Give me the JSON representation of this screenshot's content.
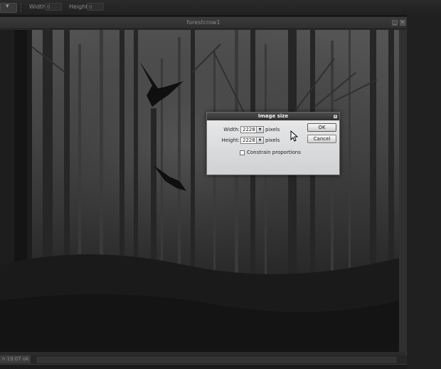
{
  "toolbar": {
    "dropdown_arrow": "▾",
    "width_label": "Width:",
    "width_value": "0",
    "height_label": "Height:",
    "height_value": "0"
  },
  "document": {
    "title": "forestcrow1",
    "status_text": "n 19.07 ok"
  },
  "dialog": {
    "title": "Image size",
    "close_glyph": "×",
    "width_label": "Width:",
    "width_value": "2228",
    "width_unit": "pixels",
    "height_label": "Height:",
    "height_value": "2228",
    "height_unit": "pixels",
    "constrain_label": "Constrain proportions",
    "constrain_checked": false,
    "ok_label": "OK",
    "cancel_label": "Cancel",
    "arrow_glyph": "▼"
  },
  "icons": [
    "dropdown-icon",
    "minimize-icon",
    "close-icon",
    "dialog-close-icon",
    "combo-arrow-icon",
    "mouse-cursor-icon",
    "crow-icon"
  ],
  "colors": {
    "dialog_bg": "#d9dadb",
    "title_bar": "#3a3a3a",
    "canvas_bg": "#2a2a2a"
  }
}
